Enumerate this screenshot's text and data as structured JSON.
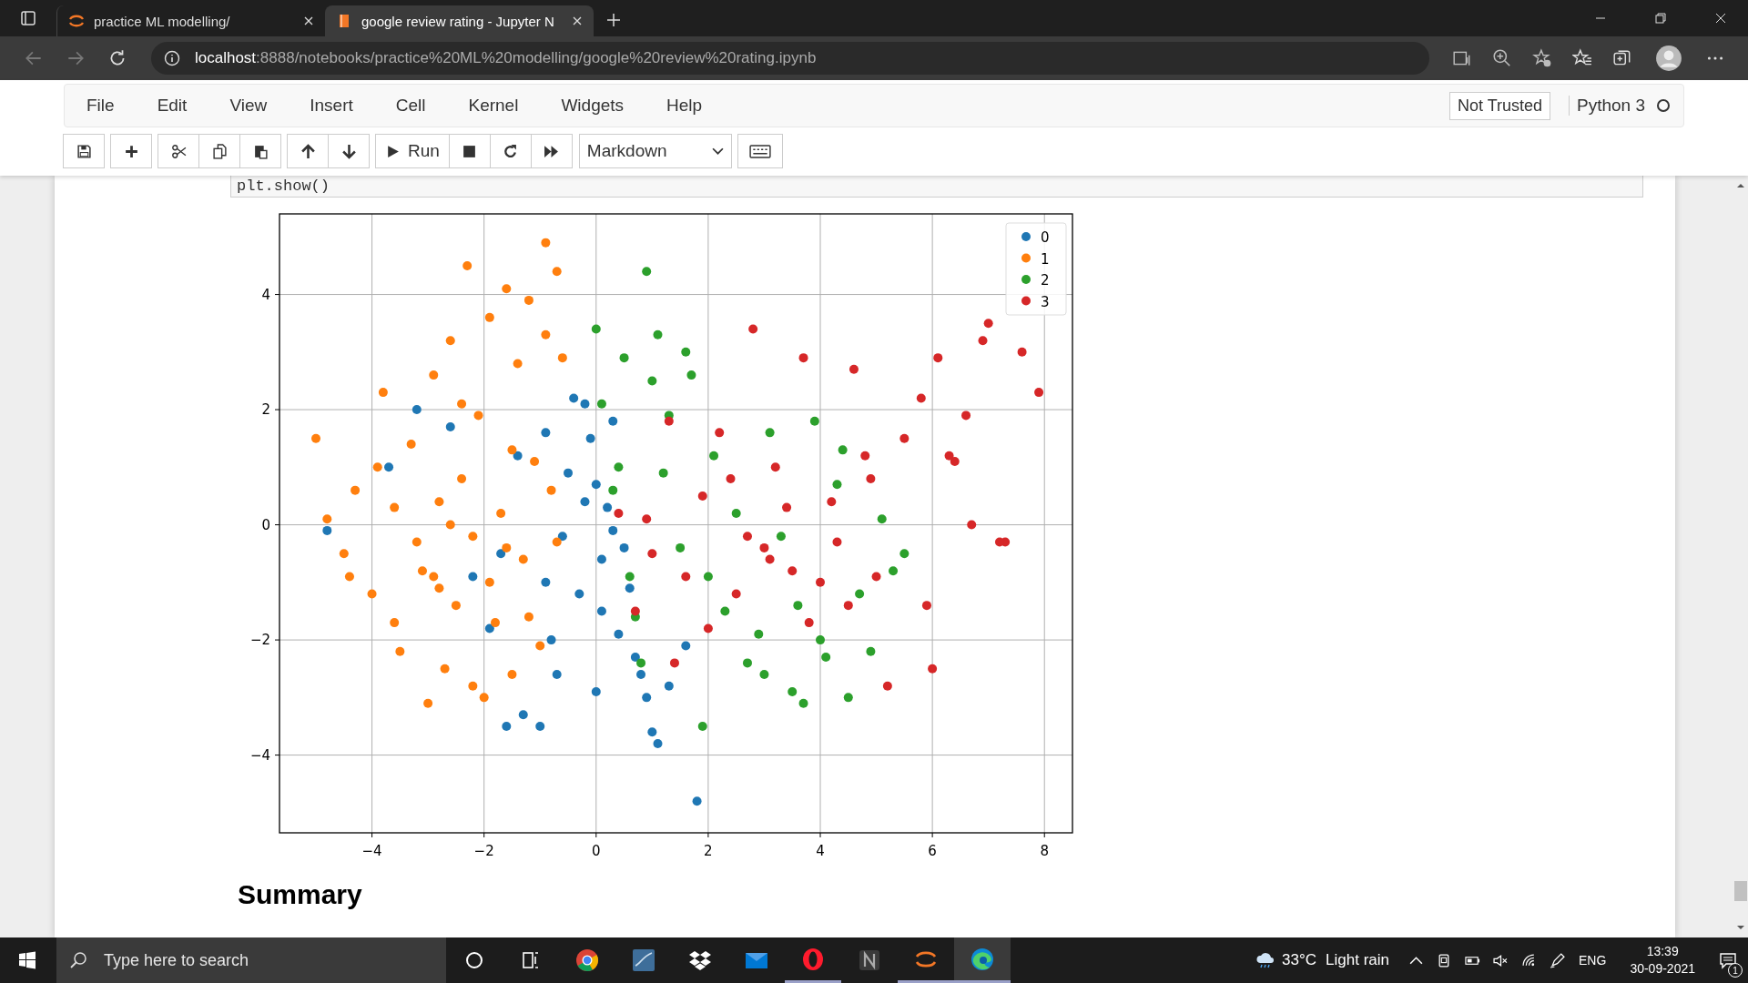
{
  "browser": {
    "tabs": [
      {
        "title": "practice ML modelling/",
        "kind": "jupyter",
        "selected": false
      },
      {
        "title": "google review rating - Jupyter N",
        "kind": "notebook",
        "selected": true
      }
    ],
    "url": {
      "host": "localhost",
      "path": ":8888/notebooks/practice%20ML%20modelling/google%20review%20rating.ipynb"
    }
  },
  "menu": {
    "items": [
      "File",
      "Edit",
      "View",
      "Insert",
      "Cell",
      "Kernel",
      "Widgets",
      "Help"
    ],
    "trust": "Not Trusted",
    "kernel": "Python 3"
  },
  "toolbar": {
    "groups": [
      [
        {
          "kind": "save"
        }
      ],
      [
        {
          "kind": "add"
        }
      ],
      [
        {
          "kind": "cut"
        },
        {
          "kind": "copy"
        },
        {
          "kind": "paste"
        }
      ],
      [
        {
          "kind": "up"
        },
        {
          "kind": "down"
        }
      ],
      [
        {
          "kind": "run",
          "label": "Run"
        },
        {
          "kind": "stop"
        },
        {
          "kind": "restart"
        },
        {
          "kind": "run-all"
        }
      ]
    ],
    "cell_type": "Markdown"
  },
  "code": "plt.show()",
  "output": {
    "chart_data": {
      "type": "scatter",
      "grid": true,
      "legend": true,
      "xlim": [
        -5.65,
        8.5
      ],
      "ylim": [
        -5.35,
        5.4
      ],
      "xticks": [
        {
          "value": -4,
          "label": "−4"
        },
        {
          "value": -2,
          "label": "−2"
        },
        0,
        2,
        4,
        6,
        8
      ],
      "yticks": [
        {
          "value": -4,
          "label": "−4"
        },
        {
          "value": -2,
          "label": "−2"
        },
        0,
        2,
        4
      ],
      "series": [
        {
          "name": "0",
          "color": "#1f77b4",
          "x": [
            -4.8,
            -3.7,
            -3.2,
            -2.6,
            -1.9,
            -1.6,
            -1.3,
            -1,
            -0.9,
            -0.7,
            -0.5,
            -0.4,
            -0.3,
            -0.2,
            -0.1,
            0,
            0.1,
            0.2,
            0.3,
            0.4,
            0.5,
            0.7,
            0.9,
            1.1,
            1.3,
            1.8,
            -1.7,
            -0.6,
            0.1,
            0.6,
            -1.4,
            -0.9,
            0,
            0.3,
            -0.2,
            -0.8,
            1,
            1.6,
            0.8,
            -2.2
          ],
          "values": [
            -0.1,
            1,
            2,
            1.7,
            -1.8,
            -3.5,
            -3.3,
            -3.5,
            1.6,
            -2.6,
            0.9,
            2.2,
            -1.2,
            0.4,
            1.5,
            -2.9,
            -0.6,
            0.3,
            -0.1,
            -1.9,
            -0.4,
            -2.3,
            -3,
            -3.8,
            -2.8,
            -4.8,
            -0.5,
            -0.2,
            -1.5,
            -1.1,
            1.2,
            -1,
            0.7,
            1.8,
            2.1,
            -2,
            -3.6,
            -2.1,
            -2.6,
            -0.9
          ]
        },
        {
          "name": "1",
          "color": "#ff7f0e",
          "x": [
            -5,
            -4.8,
            -4.5,
            -4.3,
            -4,
            -3.8,
            -3.6,
            -3.5,
            -3.3,
            -3.1,
            -3,
            -2.9,
            -2.8,
            -2.7,
            -2.6,
            -2.5,
            -2.4,
            -2.3,
            -2.2,
            -2.1,
            -2,
            -1.9,
            -1.8,
            -1.7,
            -1.6,
            -1.5,
            -1.4,
            -1.3,
            -1.2,
            -1.1,
            -1,
            -0.9,
            -0.8,
            -0.7,
            -0.6,
            -3.6,
            -2.9,
            -2.2,
            -1.5,
            -2.6,
            -3.2,
            -1.9,
            -1.2,
            -0.9,
            -2.4,
            -4.4,
            -3.9,
            -0.7,
            -1.6,
            -2.8
          ],
          "values": [
            1.5,
            0.1,
            -0.5,
            0.6,
            -1.2,
            2.3,
            0.3,
            -2.2,
            1.4,
            -0.8,
            -3.1,
            2.6,
            0.4,
            -2.5,
            3.2,
            -1.4,
            0.8,
            4.5,
            -0.2,
            1.9,
            -3,
            3.6,
            -1.7,
            0.2,
            4.1,
            -2.6,
            2.8,
            -0.6,
            3.9,
            1.1,
            -2.1,
            4.9,
            0.6,
            4.4,
            2.9,
            -1.7,
            -0.9,
            -2.8,
            1.3,
            0,
            -0.3,
            -1,
            -1.6,
            3.3,
            2.1,
            -0.9,
            1,
            -0.3,
            -0.4,
            -1.1
          ]
        },
        {
          "name": "2",
          "color": "#2ca02c",
          "x": [
            0,
            0.1,
            0.3,
            0.5,
            0.7,
            0.9,
            1.1,
            1.3,
            1.5,
            1.7,
            1.9,
            2.1,
            2.3,
            2.5,
            2.7,
            2.9,
            3.1,
            3.3,
            3.5,
            3.7,
            3.9,
            4.1,
            4.3,
            4.5,
            4.7,
            4.9,
            5.1,
            5.3,
            5.5,
            0.4,
            0.8,
            1.2,
            2,
            3,
            3.6,
            4,
            4.4,
            1,
            0.6,
            1.6
          ],
          "values": [
            3.4,
            2.1,
            0.6,
            2.9,
            -1.6,
            4.4,
            3.3,
            1.9,
            -0.4,
            2.6,
            -3.5,
            1.2,
            -1.5,
            0.2,
            -2.4,
            -1.9,
            1.6,
            -0.2,
            -2.9,
            -3.1,
            1.8,
            -2.3,
            0.7,
            -3,
            -1.2,
            -2.2,
            0.1,
            -0.8,
            -0.5,
            1,
            -2.4,
            0.9,
            -0.9,
            -2.6,
            -1.4,
            -2,
            1.3,
            2.5,
            -0.9,
            3
          ]
        },
        {
          "name": "3",
          "color": "#d62728",
          "x": [
            0.4,
            0.7,
            1,
            1.3,
            1.6,
            1.9,
            2.2,
            2.5,
            2.8,
            3.1,
            3.4,
            3.7,
            4,
            4.3,
            4.6,
            4.9,
            5.2,
            5.5,
            5.8,
            6.1,
            6.4,
            6.7,
            7,
            7.3,
            7.6,
            7.9,
            6,
            6.3,
            6.9,
            7.2,
            5,
            5.9,
            2.7,
            3.5,
            4.2,
            1.4,
            2,
            3.2,
            3.8,
            4.5,
            6.6,
            0.9,
            2.4,
            3,
            4.8
          ],
          "values": [
            0.2,
            -1.5,
            -0.5,
            1.8,
            -0.9,
            0.5,
            1.6,
            -1.2,
            3.4,
            -0.6,
            0.3,
            2.9,
            -1,
            -0.3,
            2.7,
            0.8,
            -2.8,
            1.5,
            2.2,
            2.9,
            1.1,
            0,
            3.5,
            -0.3,
            3,
            2.3,
            -2.5,
            1.2,
            3.2,
            -0.3,
            -0.9,
            -1.4,
            -0.2,
            -0.8,
            0.4,
            -2.4,
            -1.8,
            1,
            -1.7,
            -1.4,
            1.9,
            0.1,
            0.8,
            -0.4,
            1.2
          ]
        }
      ]
    }
  },
  "heading": "Summary",
  "taskbar": {
    "search": {
      "placeholder": "Type here to search"
    },
    "apps": [
      {
        "kind": "cortana",
        "running": false,
        "selected": false
      },
      {
        "kind": "taskview",
        "running": false,
        "selected": false
      },
      {
        "kind": "chrome",
        "running": false,
        "selected": false
      },
      {
        "kind": "workbench",
        "running": false,
        "selected": false
      },
      {
        "kind": "dropbox",
        "running": false,
        "selected": false
      },
      {
        "kind": "mail",
        "running": false,
        "selected": false
      },
      {
        "kind": "opera",
        "running": true,
        "selected": false
      },
      {
        "kind": "notion",
        "running": false,
        "selected": false
      },
      {
        "kind": "jupyter",
        "running": true,
        "selected": false
      },
      {
        "kind": "edge",
        "running": true,
        "selected": true
      }
    ],
    "weather": {
      "temperature": "33°C",
      "condition": "Light rain"
    },
    "language": "ENG",
    "time": "13:39",
    "date": "30-09-2021",
    "notifications": "1"
  }
}
